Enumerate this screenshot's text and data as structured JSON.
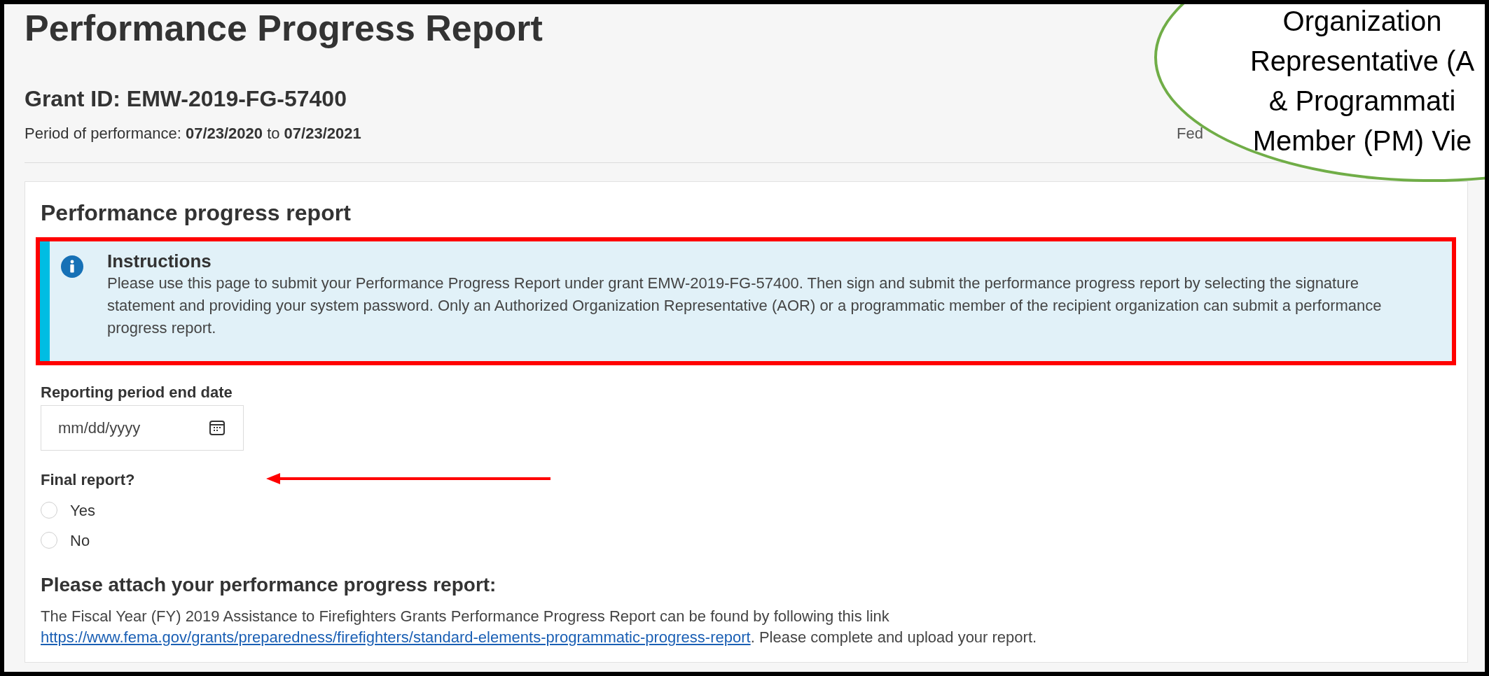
{
  "page": {
    "title": "Performance Progress Report",
    "grant_id": "Grant ID: EMW-2019-FG-57400",
    "period": "Period of performance: **07/23/2020** to **07/23/2021**",
    "federal_text": "Fed"
  },
  "card": {
    "title": "Performance progress report",
    "instructions": {
      "title": "Instructions",
      "text": "Please use this page to submit your Performance Progress Report under grant EMW-2019-FG-57400. Then sign and submit the performance progress report by selecting the signature statement and providing your system password. Only an Authorized Organization Representative (AOR) or a programmatic member of the recipient organization can submit a performance progress report."
    },
    "end_date": {
      "label": "Reporting period end date",
      "placeholder": "mm/dd/yyyy"
    },
    "final_report": {
      "label": "Final report?",
      "options": [
        {
          "label": "Yes",
          "selected": false
        },
        {
          "label": "No",
          "selected": false
        }
      ]
    },
    "attach": {
      "heading": "Please attach your performance progress report:",
      "text_before": "The Fiscal Year (FY) 2019 Assistance to Firefighters Grants Performance Progress Report can be found by following this link ",
      "link": "https://www.fema.gov/grants/preparedness/firefighters/standard-elements-programmatic-progress-report",
      "text_after": ". Please complete and upload your report."
    }
  },
  "callout": {
    "lines": [
      "Organization",
      "Representative (A",
      "& Programmati",
      "Member (PM) Vie"
    ]
  }
}
